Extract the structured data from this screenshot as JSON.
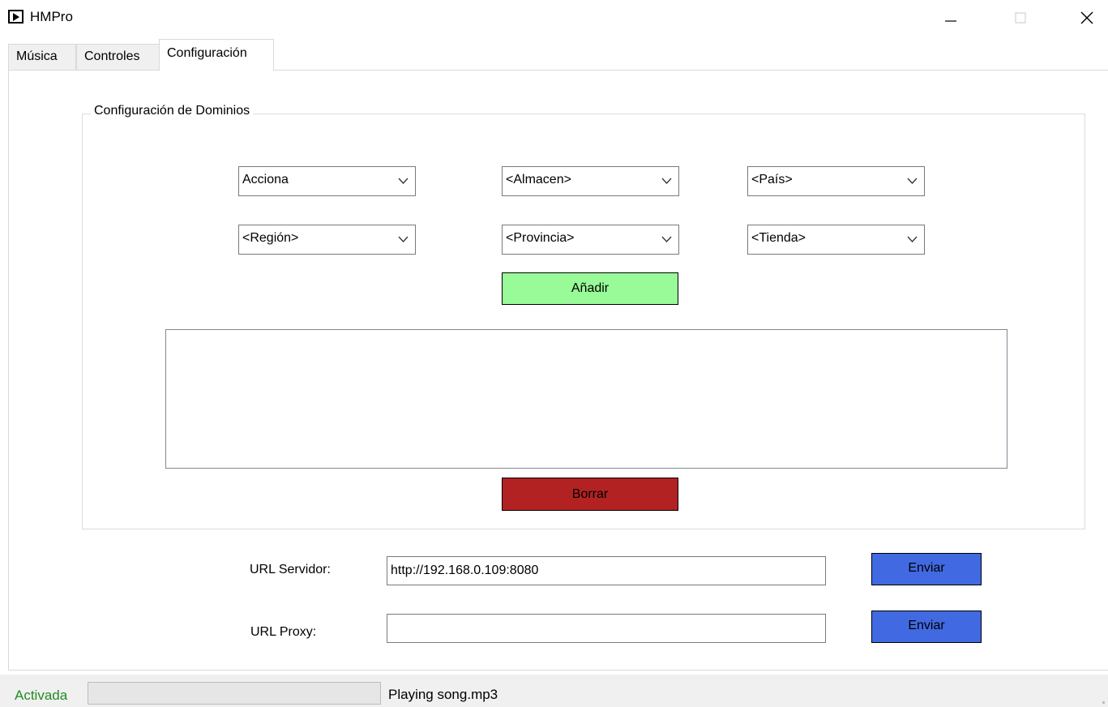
{
  "window": {
    "title": "HMPro",
    "icon": "play-icon",
    "controls": [
      "minimize-icon",
      "maximize-icon",
      "close-icon"
    ]
  },
  "tabs": [
    {
      "label": "Música",
      "active": false
    },
    {
      "label": "Controles",
      "active": false
    },
    {
      "label": "Configuración",
      "active": true
    }
  ],
  "domains": {
    "group_title": "Configuración de Dominios",
    "combos": [
      {
        "value": "Acciona"
      },
      {
        "value": "<Almacen>"
      },
      {
        "value": "<País>"
      },
      {
        "value": "<Región>"
      },
      {
        "value": "<Provincia>"
      },
      {
        "value": "<Tienda>"
      }
    ],
    "add_label": "Añadir",
    "delete_label": "Borrar",
    "list_items": []
  },
  "server": {
    "label": "URL Servidor:",
    "value": "http://192.168.0.109:8080",
    "send_label": "Enviar"
  },
  "proxy": {
    "label": "URL Proxy:",
    "value": "",
    "send_label": "Enviar"
  },
  "status": {
    "state": "Activada",
    "progress": 0,
    "message": "Playing song.mp3"
  },
  "colors": {
    "add_button": "#98fb98",
    "delete_button": "#b22222",
    "send_button": "#4169e1",
    "status_active": "#228b22"
  }
}
